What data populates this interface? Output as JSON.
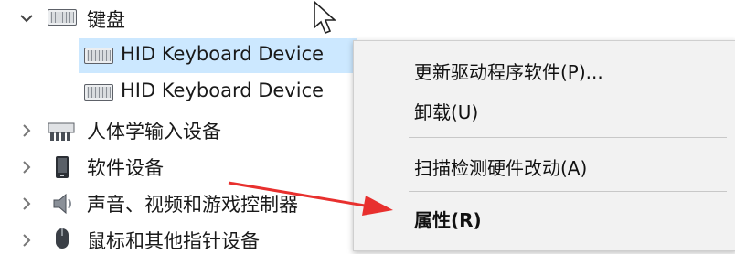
{
  "tree": {
    "keyboards": {
      "label": "键盘",
      "icon": "keyboard-icon",
      "expanded": true
    },
    "devices": [
      {
        "label": "HID Keyboard Device",
        "icon": "keyboard-icon",
        "selected": true
      },
      {
        "label": "HID Keyboard Device",
        "icon": "keyboard-icon",
        "selected": false
      }
    ],
    "categories": [
      {
        "label": "人体学输入设备",
        "icon": "hid-icon"
      },
      {
        "label": "软件设备",
        "icon": "software-device-icon"
      },
      {
        "label": "声音、视频和游戏控制器",
        "icon": "speaker-icon"
      },
      {
        "label": "鼠标和其他指针设备",
        "icon": "mouse-icon"
      }
    ]
  },
  "context_menu": {
    "update_driver": "更新驱动程序软件(P)...",
    "uninstall": "卸载(U)",
    "scan_hardware": "扫描检测硬件改动(A)",
    "properties": "属性(R)"
  },
  "colors": {
    "selection": "#cce8ff",
    "menu_bg": "#f2f2f2",
    "annotation_arrow": "#e8302e"
  }
}
